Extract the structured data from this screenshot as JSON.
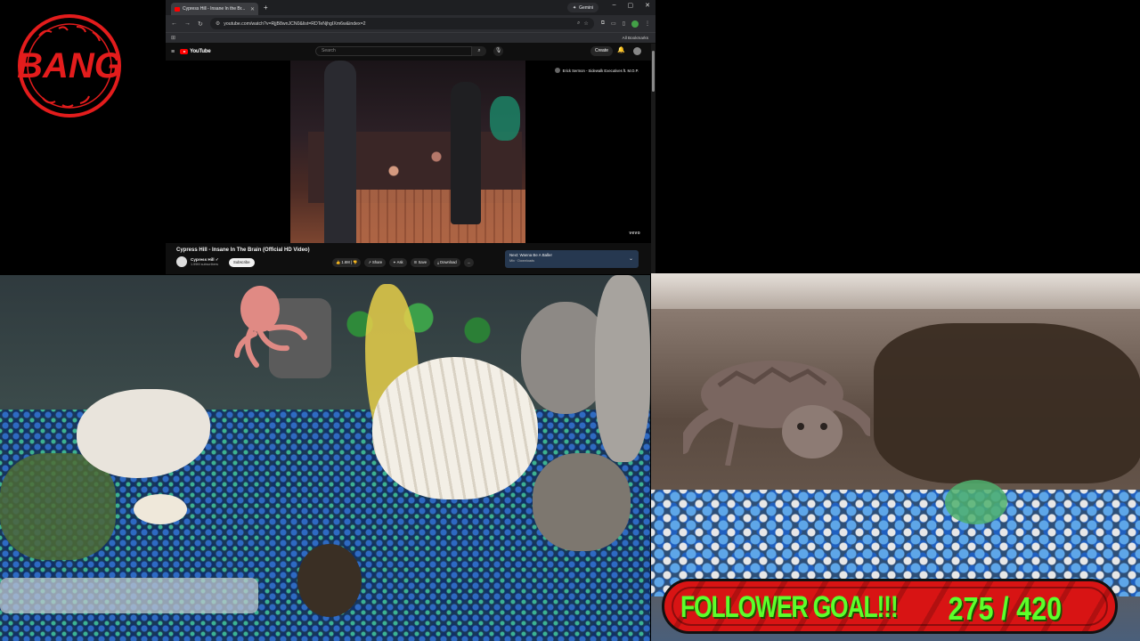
{
  "logo": {
    "text": "BANG",
    "color": "#e31c1c"
  },
  "browser": {
    "tab_title": "Cypress Hill - Insane In the Br...",
    "gemini_label": "Gemini",
    "url": "youtube.com/watch?v=RjjB8wnJCN0&list=RDTeNjhgIXm6w&index=2",
    "all_bookmarks": "All Bookmarks"
  },
  "youtube": {
    "logo_word": "YouTube",
    "search_placeholder": "Search",
    "create_label": "Create",
    "overlay_text": "Erick Sermon - Sidewalk Executives ft. M.O.P.",
    "vevo": "vevo",
    "video_title": "Cypress Hill - Insane In The Brain (Official HD Video)",
    "channel_name": "Cypress Hill ✓",
    "subscribers": "1.59M subscribers",
    "subscribe_label": "Subscribe",
    "actions": {
      "like": "1.6M",
      "share": "Share",
      "ask": "Ask",
      "save": "Save",
      "download": "Download",
      "more": "..."
    },
    "up_next_title": "Next: Wanna Be A Baller",
    "up_next_sub": "Mix · Downloads"
  },
  "goal": {
    "label": "FOLLOWER GOAL!!!",
    "current": 275,
    "target": 420,
    "display": "275 / 420"
  },
  "colors": {
    "goal_bg": "#d81414",
    "goal_text": "#5cff2b",
    "yt_red": "#ff0000"
  }
}
